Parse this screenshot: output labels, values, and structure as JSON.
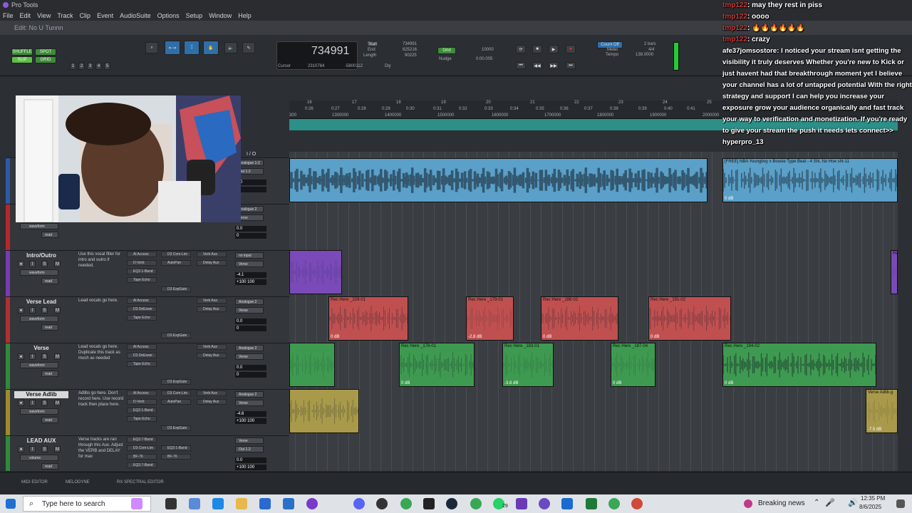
{
  "window": {
    "title": "Pro Tools",
    "doc_title": "Edit: No U Tunnn"
  },
  "menu": [
    "File",
    "Edit",
    "View",
    "Track",
    "Clip",
    "Event",
    "AudioSuite",
    "Options",
    "Setup",
    "Window",
    "Help"
  ],
  "toolbar": {
    "modes": [
      "SHUFFLE",
      "SPOT",
      "SLIP",
      "GRID"
    ],
    "zoom_presets": [
      "1",
      "2",
      "3",
      "4",
      "5"
    ],
    "counter_main": "734991",
    "start_label": "Start",
    "start_val": "734991",
    "end_label": "End",
    "end_val": "825216",
    "length_label": "Length",
    "length_val": "90225",
    "cursor_label": "Cursor",
    "cursor_val": "2310784",
    "cursor_val2": "-5800112",
    "grid_label": "Grid",
    "grid_val": "10000",
    "nudge_label": "Nudge",
    "nudge_val": "0:00.005",
    "count_off": "Count Off",
    "meter_label": "Meter",
    "meter_val": "4/4",
    "tempo_label": "Tempo",
    "tempo_val": "138.0000",
    "bars": "2 bars",
    "dly": "Dly"
  },
  "ruler": {
    "bars": [
      "16",
      "17",
      "18",
      "19",
      "20",
      "21",
      "22",
      "23",
      "24",
      "25"
    ],
    "times": [
      "0:26",
      "0:27",
      "0:28",
      "0:29",
      "0:30",
      "0:31",
      "0:32",
      "0:33",
      "0:34",
      "0:35",
      "0:36",
      "0:37",
      "0:38",
      "0:39",
      "0:40",
      "0:41"
    ],
    "samples": [
      "1300000",
      "1400000",
      "1500000",
      "1600000",
      "1700000",
      "1800000",
      "1900000",
      "2000000"
    ],
    "sample_start": "300"
  },
  "io_header": "I / O",
  "tracks": [
    {
      "name": "",
      "comment": "",
      "color": "#2a5aa8",
      "io_in": "Analogue 1-2",
      "io_out": "Out 1-2",
      "vol": "0.0",
      "pan": "0",
      "view": ""
    },
    {
      "name": "",
      "comment": "section you are working on.",
      "color": "#b8262b",
      "io_in": "Analogue 2",
      "io_out": "Verse",
      "vol": "0.0",
      "pan": "0",
      "view": "waveform",
      "mode": "read"
    },
    {
      "name": "Intro/Outro",
      "comment": "Use this vocal filter for intro and outro if needed.",
      "color": "#7a3ab0",
      "plugins": [
        "Al Access",
        "D-Verb",
        "EQ3 1-Band",
        "Tape Echo"
      ],
      "plugins2": [
        "D3 Com-Lim",
        "AutoPan",
        "",
        ""
      ],
      "sends": [
        "Verb Aux",
        "Delay Aux"
      ],
      "io_in": "no input",
      "io_out": "Verse",
      "vol": "-4.1",
      "pan": "+100  100",
      "view": "waveform",
      "mode": "read",
      "expgate": "D3 ExpGate"
    },
    {
      "name": "Verse Lead",
      "comment": "Lead vocals go here.",
      "color": "#b03030",
      "plugins": [
        "Al Access",
        "D3 DeEsser",
        "Tape Echo",
        ""
      ],
      "sends": [
        "Verb Aux",
        "Delay Aux"
      ],
      "io_in": "Analogue 2",
      "io_out": "Verse",
      "vol": "0.0",
      "pan": "0",
      "view": "waveform",
      "mode": "read",
      "expgate": "D3 ExpGate"
    },
    {
      "name": "Verse",
      "comment": "Lead vocals go here. Duplicate this track as much as needed",
      "color": "#2f8a3a",
      "plugins": [
        "Al Access",
        "D3 DeEsser",
        "Tape Echo",
        ""
      ],
      "sends": [
        "Verb Aux",
        "Delay Aux"
      ],
      "io_in": "Analogue 2",
      "io_out": "Verse",
      "vol": "0.0",
      "pan": "0",
      "view": "waveform",
      "mode": "read",
      "expgate": "D3 ExpGate"
    },
    {
      "name": "Verse Adlib",
      "comment": "Adlibs go here. Don't record here. Use record track then place here.",
      "color": "#a08a2a",
      "plugins": [
        "Al Access",
        "D-Verb",
        "EQ3 1-Band",
        "Tape Echo"
      ],
      "plugins2": [
        "D3 Com-Lim",
        "AutoPan",
        "",
        ""
      ],
      "sends": [
        "Verb Aux",
        "Delay Aux"
      ],
      "io_in": "Analogue 2",
      "io_out": "Verse",
      "vol": "-4.6",
      "pan": "+100  100",
      "view": "waveform",
      "mode": "read",
      "expgate": "D3 ExpGate"
    },
    {
      "name": "LEAD AUX",
      "comment": "Verse tracks are ran through this Aux. Adjust the VERB and DELAY for max",
      "color": "#2f8a3a",
      "plugins": [
        "EQ3 7-Band",
        "D3 Com-Lim",
        "BF-76",
        "EQ3 7-Band"
      ],
      "plugins2": [
        "",
        "EQ3 1-Band",
        "BF-76",
        ""
      ],
      "io_in": "Verse",
      "io_out": "Out 1-2",
      "vol": "0.0",
      "pan": "+100  100",
      "view": "volume",
      "mode": "read"
    }
  ],
  "clips": [
    {
      "label": "",
      "db": "",
      "color": "#5aa0c8"
    },
    {
      "label": "[FREE] NBA Youngboy x Boosie Type Beat - 4 Shi, No Hoe sht-11",
      "db": "0 dB",
      "color": "#5aa0c8"
    },
    {
      "label": "",
      "db": "",
      "color": "#7a4ab8"
    },
    {
      "label": "Re",
      "db": "",
      "color": "#7a4ab8"
    },
    {
      "label": "Rec Here _229-01",
      "db": "0 dB",
      "color": "#c05050"
    },
    {
      "label": "Rec Here _179-01",
      "db": "-2.8 dB",
      "color": "#c05050"
    },
    {
      "label": "Rec Here _186-02",
      "db": "0 dB",
      "color": "#c05050"
    },
    {
      "label": "Rec Here _191-02",
      "db": "0 dB",
      "color": "#c05050"
    },
    {
      "label": "",
      "db": "",
      "color": "#3e9a50"
    },
    {
      "label": "Rec Here _178-01",
      "db": "0 dB",
      "color": "#3e9a50"
    },
    {
      "label": "Rec Here _183-01",
      "db": "-3.8 dB",
      "color": "#3e9a50"
    },
    {
      "label": "Rec Here _187-04",
      "db": "0 dB",
      "color": "#3e9a50"
    },
    {
      "label": "Rec Here _194-02",
      "db": "0 dB",
      "color": "#3e9a50"
    },
    {
      "label": "",
      "db": "",
      "color": "#a89a4a"
    },
    {
      "label": "Verse Adlib.g",
      "db": "-7.5 dB",
      "color": "#a89a4a"
    }
  ],
  "chat": [
    {
      "user": "tmp122",
      "msg": ": may they rest in piss"
    },
    {
      "user": "tmp122",
      "msg": ": oooo"
    },
    {
      "user": "tmp122",
      "msg": ": 🔥🔥🔥🔥🔥🔥"
    },
    {
      "user": "tmp122",
      "msg": ": crazy"
    },
    {
      "user": "afe37jomsostore",
      "msg": ": I noticed your stream isnt getting the visibility it truly deserves Whether you're new to Kick or just havent had that breakthrough moment yet I believe your channel has a lot of untapped potential With the right strategy and support I can help you increase your exposure grow your audience organically and fast track your way to verification and monetization. If you're ready to give your stream the push it needs lets connect>> hyperpro_13"
    }
  ],
  "bottom_tabs": [
    "MIDI EDITOR",
    "MELODYNE",
    "RX SPECTRAL EDITOR"
  ],
  "taskbar": {
    "search_placeholder": "Type here to search",
    "news": "Breaking news",
    "time": "12:35 PM",
    "date": "8/6/2025",
    "badge": "29"
  }
}
